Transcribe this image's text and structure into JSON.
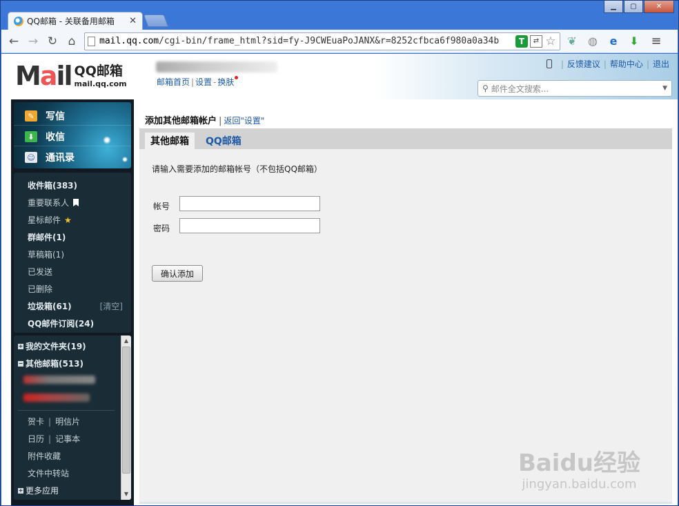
{
  "browser": {
    "tab_title": "QQ邮箱 - 关联备用邮箱",
    "url_host": "mail.qq.com",
    "url_path": "/cgi-bin/frame_html?sid=fy-J9CWEuaPoJANX&r=8252cfbca6f980a0a34b"
  },
  "header": {
    "logo_mark_1": "M",
    "logo_mark_2": "a",
    "logo_mark_3": "il",
    "logo_line1": "QQ邮箱",
    "logo_line2": "mail.qq.com",
    "links": {
      "home": "邮箱首页",
      "settings": "设置",
      "skin": "换肤"
    },
    "top_right": {
      "feedback": "反馈建议",
      "help": "帮助中心",
      "logout": "退出"
    },
    "search_placeholder": "邮件全文搜索..."
  },
  "sidebar": {
    "compose": "写信",
    "inbox_btn": "收信",
    "contacts": "通讯录",
    "folders": {
      "inbox": "收件箱(383)",
      "vip": "重要联系人",
      "starred": "星标邮件",
      "group": "群邮件(1)",
      "drafts": "草稿箱(1)",
      "sent": "已发送",
      "deleted": "已删除",
      "spam": "垃圾箱(61)",
      "clear": "[清空]",
      "subscriptions": "QQ邮件订阅(24)"
    },
    "my_folders": "我的文件夹(19)",
    "other_mailboxes": "其他邮箱(513)",
    "cards": "贺卡",
    "postcards": "明信片",
    "calendar": "日历",
    "notes": "记事本",
    "attachments": "附件收藏",
    "transfer": "文件中转站",
    "more_apps": "更多应用"
  },
  "main": {
    "title": "添加其他邮箱帐户",
    "back_link": "返回\"设置\"",
    "tabs": [
      "其他邮箱",
      "QQ邮箱"
    ],
    "hint": "请输入需要添加的邮箱帐号（不包括QQ邮箱）",
    "account_label": "帐号",
    "password_label": "密码",
    "account_value": "",
    "password_value": "",
    "confirm_label": "确认添加"
  },
  "watermark": {
    "line1": "Baidu经验",
    "line2": "jingyan.baidu.com"
  }
}
